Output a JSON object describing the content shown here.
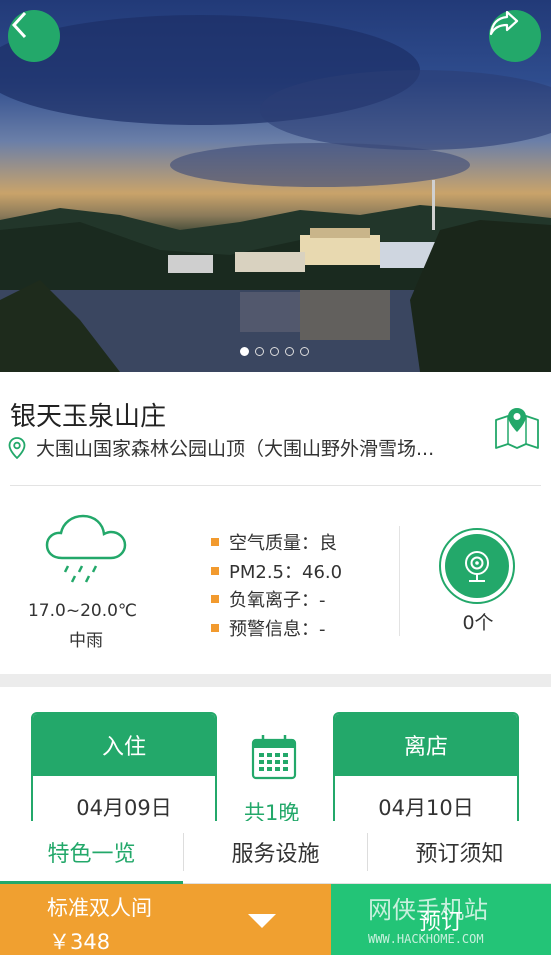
{
  "hero": {
    "image_name": "resort-lake-dusk-photo",
    "slide_count": 5,
    "active_slide": 1
  },
  "hotel": {
    "name": "银天玉泉山庄",
    "address": "大围山国家森林公园山顶（大围山野外滑雪场..."
  },
  "weather": {
    "temp": "17.0~20.0℃",
    "condition": "中雨",
    "air": [
      {
        "label": "空气质量：良"
      },
      {
        "label": "PM2.5：46.0"
      },
      {
        "label": "负氧离子：-"
      },
      {
        "label": "预警信息：-"
      }
    ],
    "camera_count": "0个"
  },
  "booking": {
    "checkin_label": "入住",
    "checkin_date": "04月09日",
    "checkout_label": "离店",
    "checkout_date": "04月10日",
    "nights": "共1晚"
  },
  "tabs": [
    {
      "label": "特色一览",
      "active": true
    },
    {
      "label": "服务设施",
      "active": false
    },
    {
      "label": "预订须知",
      "active": false
    }
  ],
  "bottom": {
    "room_name": "标准双人间",
    "price": "￥348",
    "book_label": "预订"
  },
  "watermark": {
    "text": "网侠手机站",
    "url": "WWW.HACKHOME.COM"
  },
  "colors": {
    "primary_green": "#23a86a",
    "accent_orange": "#f0a030",
    "book_green": "#23c477"
  }
}
